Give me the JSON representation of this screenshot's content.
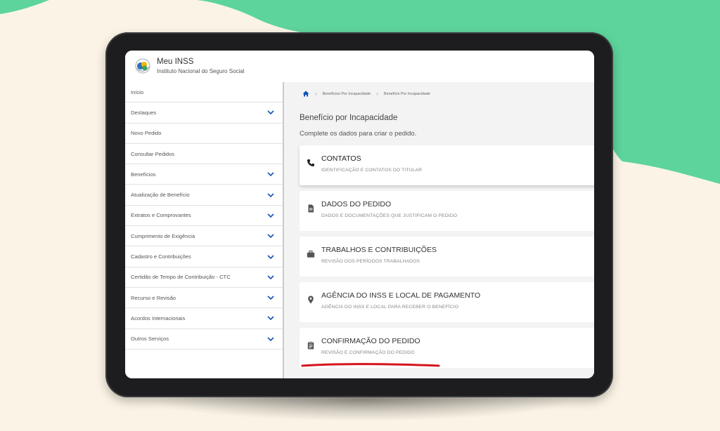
{
  "colors": {
    "background": "#fbf4e6",
    "wave": "#5dd49b",
    "tablet_frame": "#1d1d1f",
    "annotation_underline": "#d4141c",
    "home_icon": "#1351b4"
  },
  "app": {
    "title": "Meu INSS",
    "subtitle": "Instituto Nacional do Seguro Social",
    "logo_icon": "inss-logo-icon"
  },
  "sidebar": {
    "items": [
      {
        "label": "Início",
        "expandable": false
      },
      {
        "label": "Destaques",
        "expandable": true
      },
      {
        "label": "Novo Pedido",
        "expandable": false
      },
      {
        "label": "Consultar Pedidos",
        "expandable": false
      },
      {
        "label": "Benefícios",
        "expandable": true
      },
      {
        "label": "Atualização de Benefício",
        "expandable": true
      },
      {
        "label": "Extratos e Comprovantes",
        "expandable": true
      },
      {
        "label": "Cumprimento de Exigência",
        "expandable": true
      },
      {
        "label": "Cadastro e Contribuições",
        "expandable": true
      },
      {
        "label": "Certidão de Tempo de Contribuição - CTC",
        "expandable": true
      },
      {
        "label": "Recurso e Revisão",
        "expandable": true
      },
      {
        "label": "Acordos Internacionais",
        "expandable": true
      },
      {
        "label": "Outros Serviços",
        "expandable": true
      }
    ]
  },
  "breadcrumb": {
    "home_icon": "home-icon",
    "items": [
      "Benefícios Por Incapacidade",
      "Benefício Por Incapacidade"
    ]
  },
  "main": {
    "title": "Benefício por Incapacidade",
    "subtitle": "Complete os dados para criar o pedido."
  },
  "steps": [
    {
      "title": "CONTATOS",
      "subtitle": "IDENTIFICAÇÃO E CONTATOS DO TITULAR",
      "icon": "phone-icon",
      "active": true
    },
    {
      "title": "DADOS DO PEDIDO",
      "subtitle": "DADOS E DOCUMENTAÇÕES QUE JUSTIFICAM O PEDIDO",
      "icon": "document-icon",
      "active": false
    },
    {
      "title": "TRABALHOS E CONTRIBUIÇÕES",
      "subtitle": "REVISÃO DOS PERÍODOS TRABALHADOS",
      "icon": "briefcase-icon",
      "active": false
    },
    {
      "title": "AGÊNCIA DO INSS E LOCAL DE PAGAMENTO",
      "subtitle": "AGÊNCIA DO INSS E LOCAL PARA RECEBER O BENEFÍCIO",
      "icon": "location-pin-icon",
      "active": false
    },
    {
      "title": "CONFIRMAÇÃO DO PEDIDO",
      "subtitle": "REVISÃO E CONFIRMAÇÃO DO PEDIDO",
      "icon": "clipboard-icon",
      "active": false
    }
  ]
}
